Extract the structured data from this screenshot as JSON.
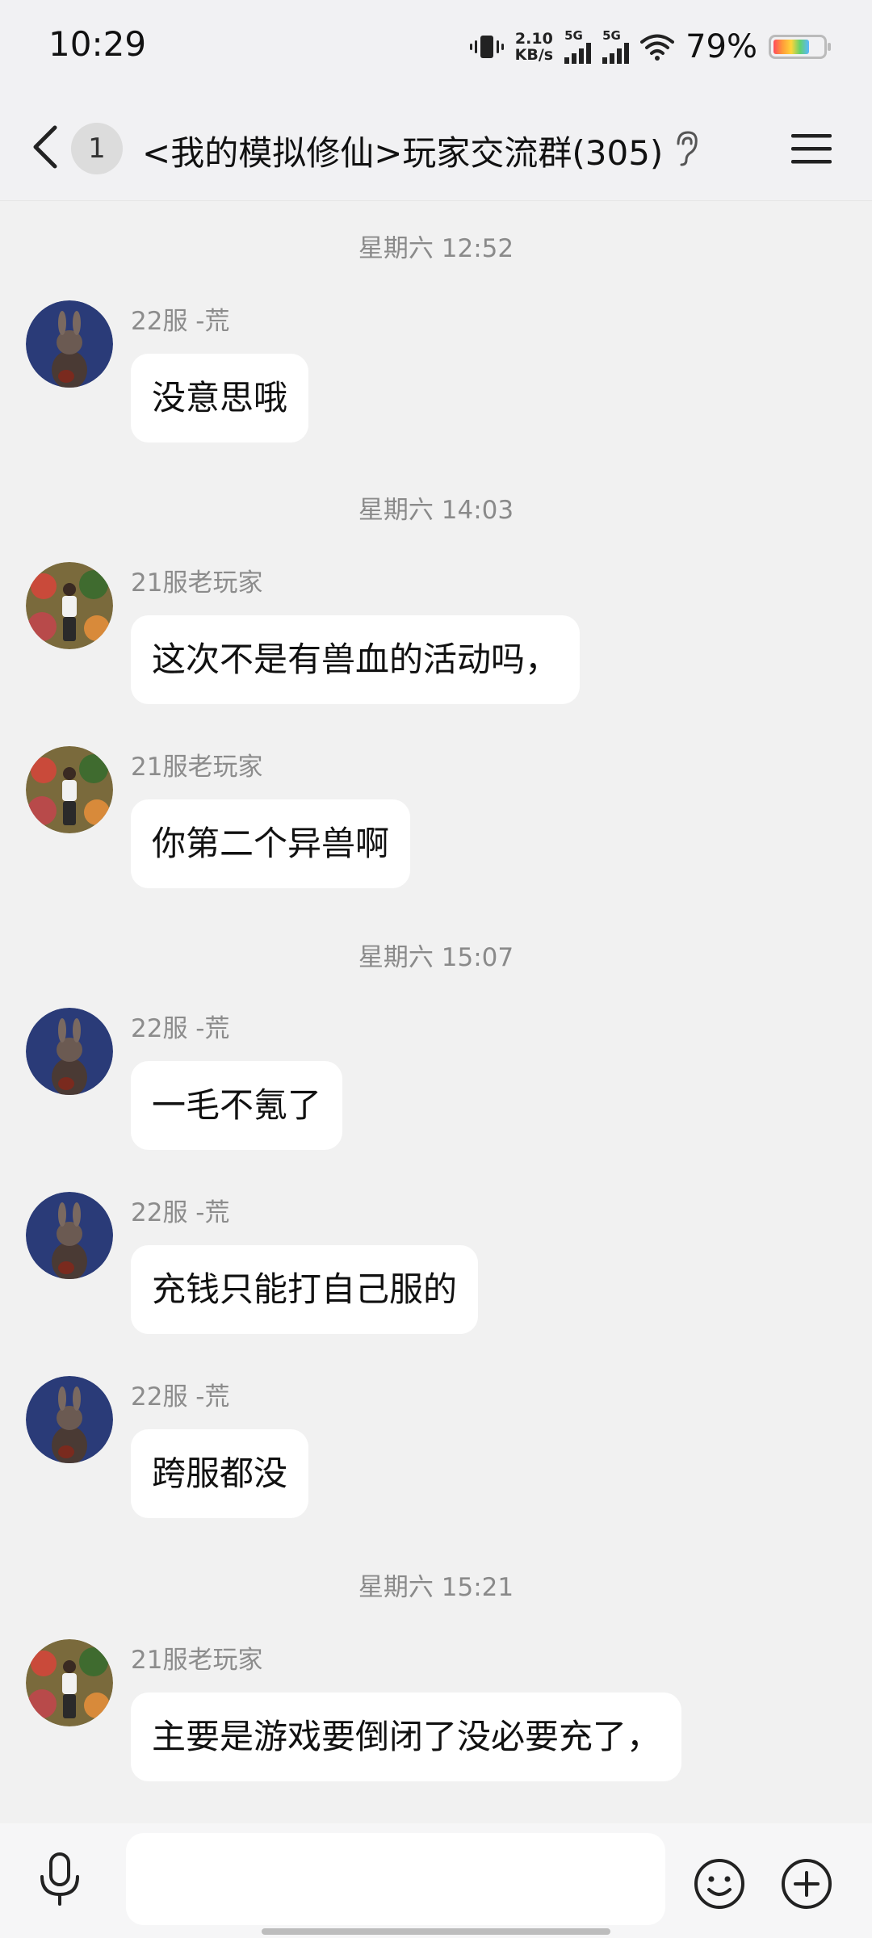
{
  "status_bar": {
    "time": "10:29",
    "net_speed_value": "2.10",
    "net_speed_unit": "KB/s",
    "net_type_1": "5G",
    "net_type_2": "5G",
    "battery_text": "79%",
    "battery_level": 0.79,
    "icons": [
      "vibrate-icon",
      "signal-icon",
      "wifi-icon",
      "battery-icon"
    ]
  },
  "header": {
    "unread_count": "1",
    "title": "<我的模拟修仙>玩家交流群(305)",
    "icons": [
      "back-icon",
      "ear-icon",
      "menu-icon"
    ]
  },
  "chat": {
    "timestamps": [
      "星期六 12:52",
      "星期六 14:03",
      "星期六 15:07",
      "星期六 15:21"
    ],
    "messages": [
      {
        "sender": "22服 -荒",
        "text": "没意思哦",
        "avatar": "rabbit-avatar"
      },
      {
        "sender": "21服老玩家",
        "text": "这次不是有兽血的活动吗，",
        "avatar": "person-avatar"
      },
      {
        "sender": "21服老玩家",
        "text": "你第二个异兽啊",
        "avatar": "person-avatar"
      },
      {
        "sender": "22服 -荒",
        "text": "一毛不氪了",
        "avatar": "rabbit-avatar"
      },
      {
        "sender": "22服 -荒",
        "text": "充钱只能打自己服的",
        "avatar": "rabbit-avatar"
      },
      {
        "sender": "22服 -荒",
        "text": "跨服都没",
        "avatar": "rabbit-avatar"
      },
      {
        "sender": "21服老玩家",
        "text": "主要是游戏要倒闭了没必要充了，",
        "avatar": "person-avatar"
      }
    ]
  },
  "input_bar": {
    "placeholder": "",
    "icons": [
      "microphone-icon",
      "emoji-icon",
      "plus-icon"
    ]
  }
}
